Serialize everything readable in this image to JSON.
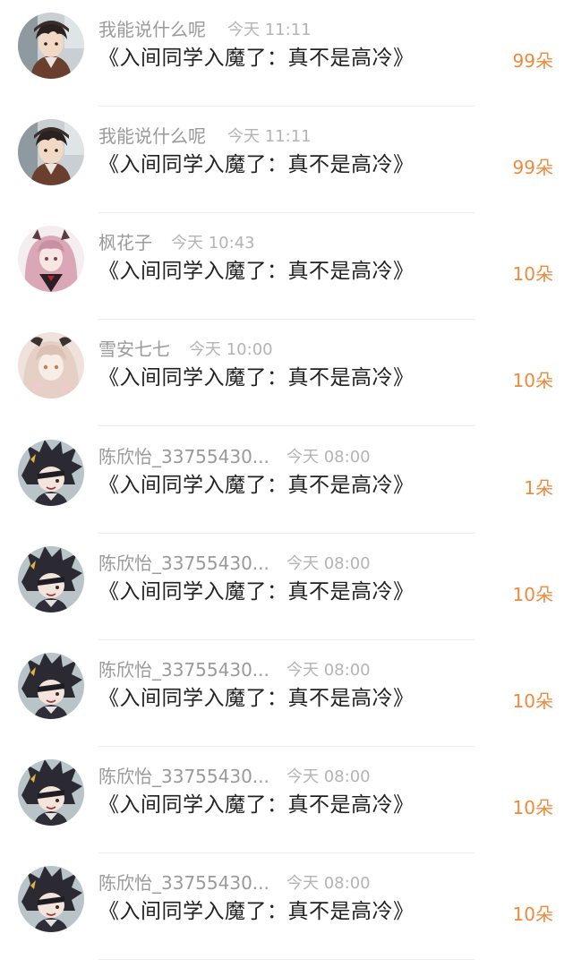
{
  "rows": [
    {
      "name": "我能说什么呢",
      "time": "今天 11:11",
      "title": "《入间同学入魔了：真不是高冷》",
      "gift": "99朵",
      "avatar": "dark-hair-boy-avatar"
    },
    {
      "name": "我能说什么呢",
      "time": "今天 11:11",
      "title": "《入间同学入魔了：真不是高冷》",
      "gift": "99朵",
      "avatar": "dark-hair-boy-avatar"
    },
    {
      "name": "枫花子",
      "time": "今天 10:43",
      "title": "《入间同学入魔了：真不是高冷》",
      "gift": "10朵",
      "avatar": "pink-hair-girl-avatar"
    },
    {
      "name": "雪安七七",
      "time": "今天 10:00",
      "title": "《入间同学入魔了：真不是高冷》",
      "gift": "10朵",
      "avatar": "pale-girl-avatar"
    },
    {
      "name": "陈欣怡_33755430...",
      "time": "今天 08:00",
      "title": "《入间同学入魔了：真不是高冷》",
      "gift": "1朵",
      "avatar": "spiky-hair-eyepatch-avatar"
    },
    {
      "name": "陈欣怡_33755430...",
      "time": "今天 08:00",
      "title": "《入间同学入魔了：真不是高冷》",
      "gift": "10朵",
      "avatar": "spiky-hair-eyepatch-avatar"
    },
    {
      "name": "陈欣怡_33755430...",
      "time": "今天 08:00",
      "title": "《入间同学入魔了：真不是高冷》",
      "gift": "10朵",
      "avatar": "spiky-hair-eyepatch-avatar"
    },
    {
      "name": "陈欣怡_33755430...",
      "time": "今天 08:00",
      "title": "《入间同学入魔了：真不是高冷》",
      "gift": "10朵",
      "avatar": "spiky-hair-eyepatch-avatar"
    },
    {
      "name": "陈欣怡_33755430...",
      "time": "今天 08:00",
      "title": "《入间同学入魔了：真不是高冷》",
      "gift": "10朵",
      "avatar": "spiky-hair-eyepatch-avatar"
    }
  ],
  "colors": {
    "gift": "#ee8a3c",
    "name": "#9a9a9a",
    "time": "#b4b4b4",
    "title": "#222222"
  }
}
